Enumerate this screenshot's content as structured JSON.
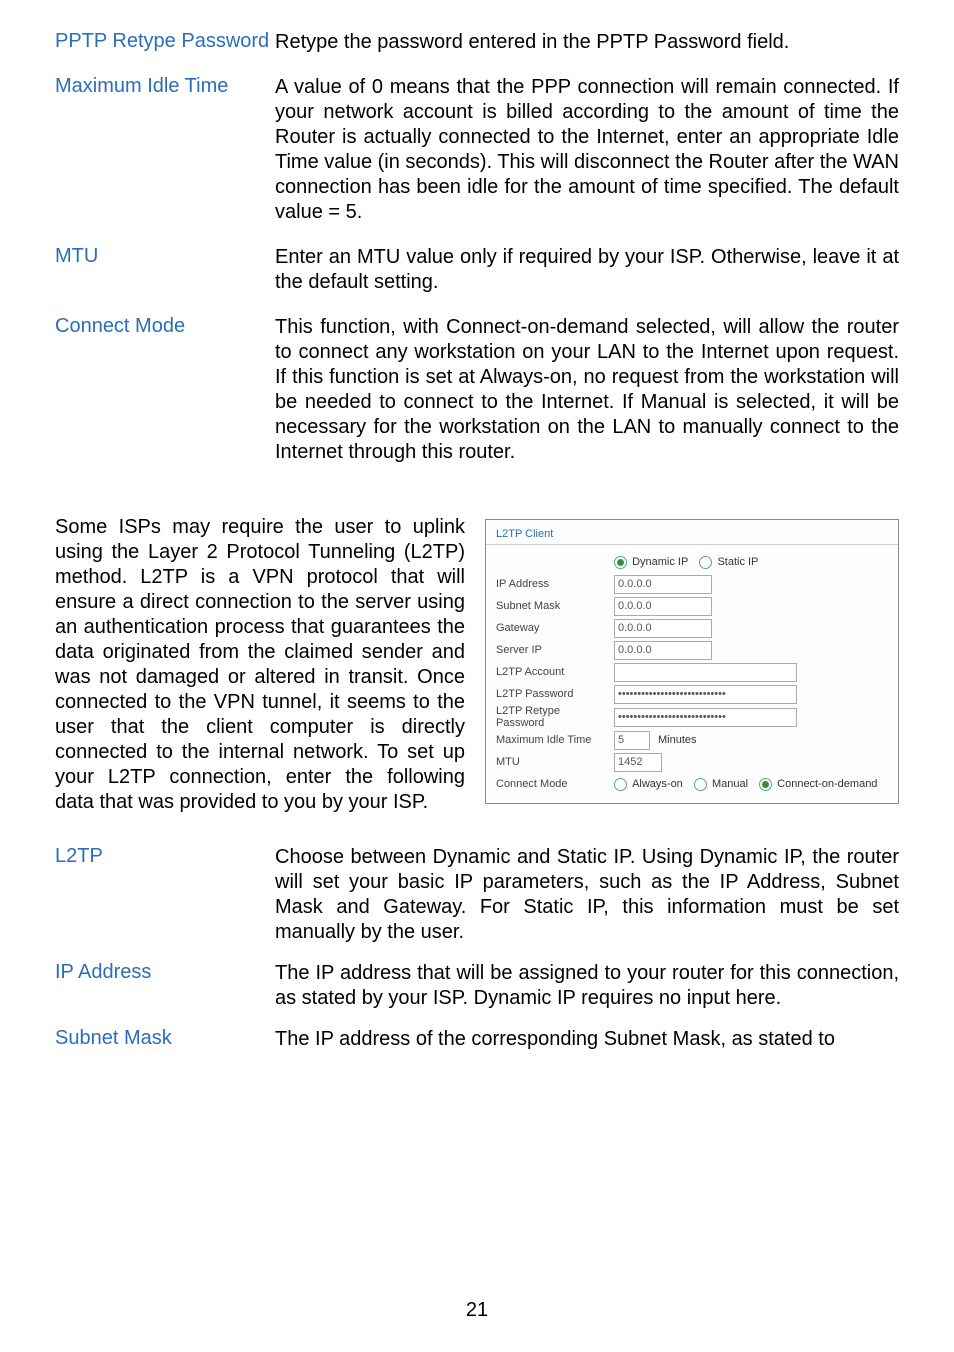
{
  "defs_top": [
    {
      "term": "PPTP Retype Password",
      "desc": "Retype the password entered in the PPTP Password field."
    },
    {
      "term": "Maximum Idle Time",
      "desc": "A value of 0 means that the PPP connection will remain connected. If your network account is billed according to the amount of time the Router is actually connected to the Internet, enter an appropriate Idle Time value (in seconds). This will disconnect the Router after the WAN connection has been idle for the amount of time specified. The default value = 5."
    },
    {
      "term": "MTU",
      "desc": "Enter an MTU value only if required by your ISP. Otherwise, leave it at the default setting."
    },
    {
      "term": "Connect Mode",
      "desc": "This function, with Connect-on-demand selected, will allow the router to connect any workstation on your LAN to the Internet upon request. If this function is set at Always-on, no request from the workstation will be needed to connect to the Internet. If Manual is selected, it will be necessary for the workstation on the LAN to manually connect to the Internet through this router."
    }
  ],
  "intro": "Some ISPs may require the user to uplink using the Layer 2 Protocol Tunneling (L2TP) method. L2TP is a VPN protocol that will ensure a direct connection to the server using an authentication process that guarantees the data originated from the claimed sender and was not damaged or altered in transit. Once connected to the VPN tunnel, it seems to the user that the client computer is directly connected to the internal network. To set up your L2TP connection, enter the following data that was provided to you by your ISP.",
  "figure": {
    "title": "L2TP Client",
    "radio_top": {
      "dynamic": "Dynamic IP",
      "static": "Static IP"
    },
    "rows": {
      "ip_address_label": "IP Address",
      "ip_address_value": "0.0.0.0",
      "subnet_mask_label": "Subnet Mask",
      "subnet_mask_value": "0.0.0.0",
      "gateway_label": "Gateway",
      "gateway_value": "0.0.0.0",
      "server_ip_label": "Server IP",
      "server_ip_value": "0.0.0.0",
      "account_label": "L2TP Account",
      "account_value": "",
      "password_label": "L2TP Password",
      "password_value": "••••••••••••••••••••••••••••",
      "retype_label": "L2TP Retype Password",
      "retype_value": "••••••••••••••••••••••••••••",
      "idle_label": "Maximum Idle Time",
      "idle_value": "5",
      "idle_unit": "Minutes",
      "mtu_label": "MTU",
      "mtu_value": "1452",
      "connect_label": "Connect Mode",
      "connect_always": "Always-on",
      "connect_manual": "Manual",
      "connect_demand": "Connect-on-demand"
    }
  },
  "defs_bottom": [
    {
      "term": "L2TP",
      "desc": " Choose between Dynamic and Static IP. Using Dynamic IP, the router will set your basic IP parameters, such as the IP Address, Subnet Mask and Gateway. For Static IP, this information must be set manually by the user."
    },
    {
      "term": "IP Address",
      "desc": "The IP address that will be assigned to your router for this connection, as stated by your ISP. Dynamic IP requires no input here."
    },
    {
      "term": "Subnet Mask",
      "desc": "The IP address of the corresponding Subnet Mask, as stated to"
    }
  ],
  "page_number": "21"
}
